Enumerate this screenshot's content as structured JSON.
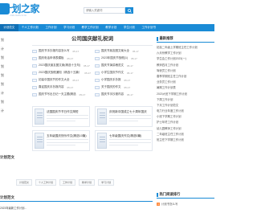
{
  "brand": {
    "logo_text": "计划之家",
    "logo_sub": "JIHUAZHIJIA",
    "accent": "#1a8bd6"
  },
  "search": {
    "placeholder": "请输入关键词"
  },
  "nav": {
    "items": [
      "计划范文",
      "个人工作计划",
      "工作计划",
      "学习计划",
      "教学工作计划",
      "教学计划",
      "学生计划",
      "工作计划书"
    ]
  },
  "sidebar": {
    "items": [
      "划",
      "计",
      "划",
      "划",
      "划",
      "划",
      "计",
      "划",
      "计"
    ]
  },
  "main": {
    "title": "公司国庆献礼祝词"
  },
  "articles": {
    "left": [
      {
        "title": "国庆节手抄报内容怎么写",
        "date": "05-17"
      },
      {
        "title": "国庆电话申请表模板",
        "date": "05-17"
      },
      {
        "title": "2023国庆朋友圈文案(精选十五句)",
        "date": "05-17"
      },
      {
        "title": "2023国庆放假通知（精选十五篇）",
        "date": "05-17"
      },
      {
        "title": "初高中国庆节的作文大全",
        "date": "05-17"
      },
      {
        "title": "喜迎国庆手抄报内容",
        "date": "05-17"
      },
      {
        "title": "国庆节写出日记一天主题(精选",
        "date": "05-17"
      }
    ],
    "right": [
      {
        "title": "国庆节朋友圈文案大全",
        "date": "05-17"
      },
      {
        "title": "2023年国庆节放假(1)",
        "date": "05-17"
      },
      {
        "title": "国庆节演讲稿范文",
        "date": "05-17"
      },
      {
        "title": "小学生国庆节作文",
        "date": "05-17"
      },
      {
        "title": "小学国庆手抄报",
        "date": "05-17"
      },
      {
        "title": "关于国庆的作文",
        "date": "05-17"
      },
      {
        "title": "国庆节手抄报内容",
        "date": "05-17"
      }
    ]
  },
  "cards": [
    {
      "title": "法国国庆节节日作文简短"
    },
    {
      "title": "庆祝新中国成立七十周年国庆"
    },
    {
      "title": "五年级国庆快乐作文(精选10篇)"
    },
    {
      "title": "七年级国庆作文(精选5篇)"
    }
  ],
  "sections": {
    "plan_title": "计划范文",
    "tags": [
      "计划范文",
      "个人工作计划",
      "工作计划",
      "教学计划",
      "学习计划"
    ],
    "bottom_title": "计划范文",
    "bottom_row": "2023年最新工作计划..."
  },
  "right_col": {
    "title": "最新推荐",
    "items": [
      "初高二年级上学期班主任工作计划",
      "六月份教学工作计划",
      "学生会工作计划2023(一)",
      "教师四月工作计划",
      "驾驶员工作计划",
      "春季学期班主任工作计划",
      "业务员工作计划",
      "暑期工作计划表",
      "2023大班下学期工作计划",
      "下周工作计划",
      "下月工作计划范文",
      "电力行业年度工作计划",
      "小班下学期工作计划",
      "护士年终工作计划",
      "幼儿园教师工作计划",
      "二年级班主任工作计划",
      "班主任下学期工作计划"
    ]
  },
  "right_bottom": {
    "title": "热门阅读排行",
    "items": [
      {
        "num": "1",
        "title": "计划书怎么写"
      }
    ]
  }
}
